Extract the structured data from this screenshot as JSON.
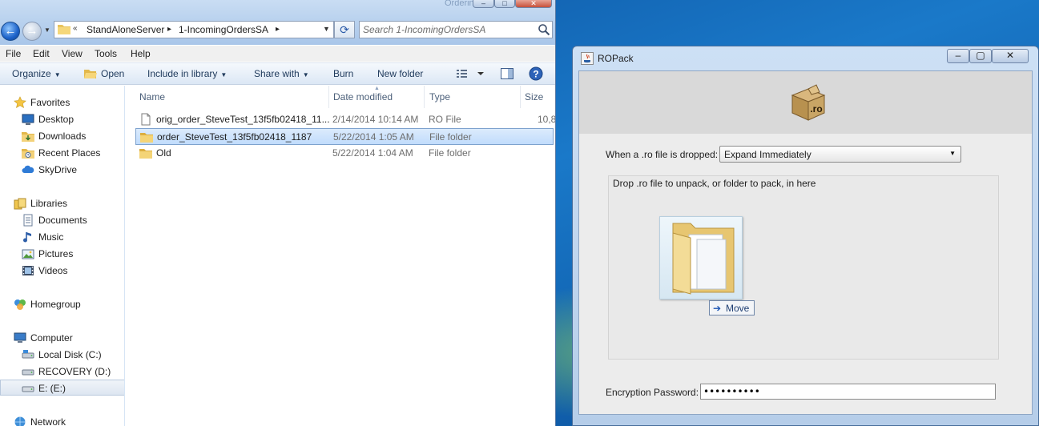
{
  "explorer": {
    "ghost_title": "Ordering Tool",
    "address": {
      "crumbs": [
        "StandAloneServer",
        "1-IncomingOrdersSA"
      ],
      "root_chevron": "«",
      "sep": "▸"
    },
    "search": {
      "placeholder": "Search 1-IncomingOrdersSA"
    },
    "menu": [
      "File",
      "Edit",
      "View",
      "Tools",
      "Help"
    ],
    "toolbar": {
      "organize": "Organize",
      "open": "Open",
      "include": "Include in library",
      "share": "Share with",
      "burn": "Burn",
      "new_folder": "New folder"
    },
    "nav": {
      "favorites": "Favorites",
      "desktop": "Desktop",
      "downloads": "Downloads",
      "recent": "Recent Places",
      "skydrive": "SkyDrive",
      "libraries": "Libraries",
      "documents": "Documents",
      "music": "Music",
      "pictures": "Pictures",
      "videos": "Videos",
      "homegroup": "Homegroup",
      "computer": "Computer",
      "local_disk": "Local Disk (C:)",
      "recovery": "RECOVERY (D:)",
      "e_drive": "E: (E:)",
      "network": "Network"
    },
    "columns": {
      "name": "Name",
      "date": "Date modified",
      "type": "Type",
      "size": "Size"
    },
    "files": [
      {
        "name": "orig_order_SteveTest_13f5fb02418_11...",
        "date": "2/14/2014 10:14 AM",
        "type": "RO File",
        "size": "10,8",
        "icon": "file-icon"
      },
      {
        "name": "order_SteveTest_13f5fb02418_1187",
        "date": "5/22/2014 1:05 AM",
        "type": "File folder",
        "size": "",
        "icon": "folder-icon"
      },
      {
        "name": "Old",
        "date": "5/22/2014 1:04 AM",
        "type": "File folder",
        "size": "",
        "icon": "folder-icon"
      }
    ]
  },
  "ropack": {
    "title": "ROPack",
    "logo_text": ".ro",
    "drop_label": "When a .ro file is dropped:",
    "drop_option": "Expand Immediately",
    "zone_title": "Drop .ro file to unpack, or folder to pack, in here",
    "move_label": "Move",
    "password_label": "Encryption Password:",
    "password_value": "••••••••••"
  },
  "colors": {
    "selection": "#c1dcfc",
    "accent": "#1f57b5",
    "titlebar": "#b8d1ee"
  }
}
